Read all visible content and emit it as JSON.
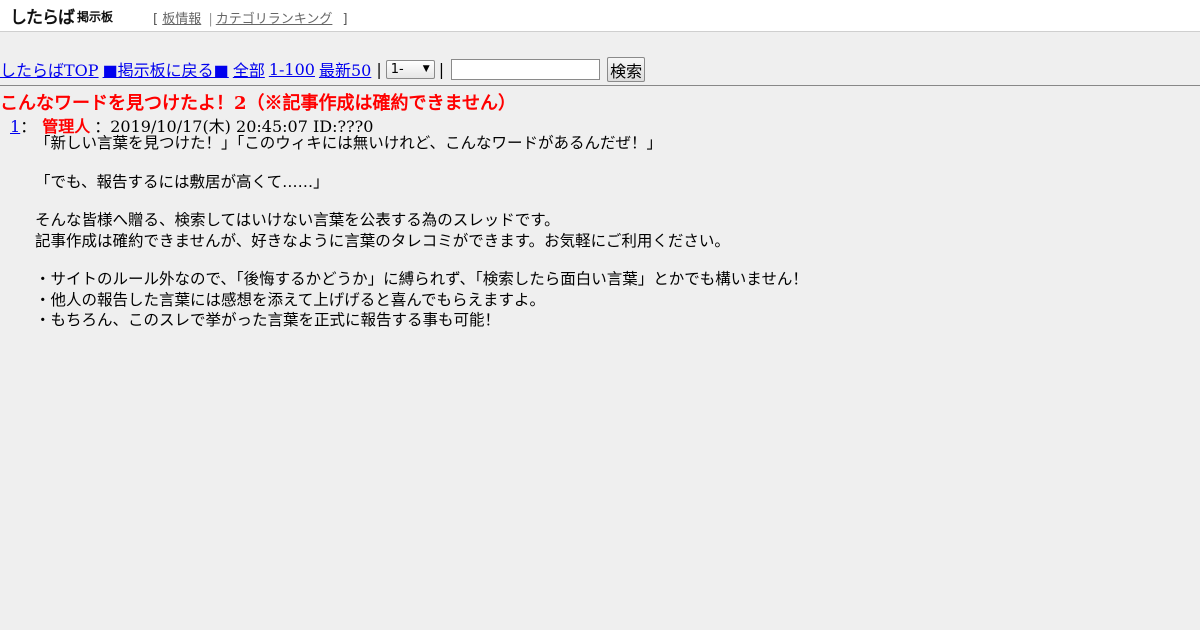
{
  "header": {
    "logo_text": "したらば",
    "logo_subtext": "掲示板",
    "bracket_open": "[",
    "bracket_close": "]",
    "links": [
      {
        "label": "板情報"
      },
      {
        "label": "カテゴリランキング"
      }
    ],
    "separator": "|"
  },
  "nav": {
    "links": [
      {
        "label": "したらばTOP"
      },
      {
        "label": "■掲示板に戻る■"
      },
      {
        "label": "全部"
      },
      {
        "label": "1-100"
      },
      {
        "label": "最新50"
      }
    ],
    "pipe": "|",
    "select": {
      "value": "1-"
    },
    "search_input": {
      "value": ""
    },
    "search_button": "検索"
  },
  "thread": {
    "title": "こんなワードを見つけたよ！2（※記事作成は確約できません）"
  },
  "post": {
    "number": "1",
    "colon": "：",
    "name": "管理人",
    "meta": "：2019/10/17(木) 20:45:07 ID:???0",
    "lines": [
      "「新しい言葉を見つけた！」「このウィキには無いけれど、こんなワードがあるんだぜ！」",
      "",
      "「でも、報告するには敷居が高くて……」",
      "",
      "そんな皆様へ贈る、検索してはいけない言葉を公表する為のスレッドです。",
      "記事作成は確約できませんが、好きなように言葉のタレコミができます。お気軽にご利用ください。",
      "",
      "・サイトのルール外なので、「後悔するかどうか」に縛られず、「検索したら面白い言葉」とかでも構いません！",
      "・他人の報告した言葉には感想を添えて上げげると喜んでもらえますよ。",
      "・もちろん、このスレで挙がった言葉を正式に報告する事も可能！"
    ]
  },
  "colors": {
    "title_red": "#ff0000",
    "link_blue": "#0000ee",
    "background": "#efefef"
  }
}
